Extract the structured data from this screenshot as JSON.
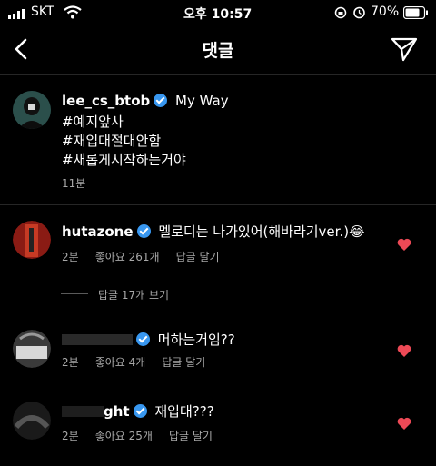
{
  "status_bar": {
    "carrier": "SKT",
    "time": "오후 10:57",
    "battery": "70%",
    "icons": [
      "signal-icon",
      "wifi-icon",
      "rotation-lock-icon",
      "alarm-icon",
      "battery-icon"
    ]
  },
  "header": {
    "title": "댓글",
    "back_icon": "chevron-left-icon",
    "share_icon": "paper-plane-icon"
  },
  "caption": {
    "username": "lee_cs_btob",
    "text": "My Way",
    "lines": [
      "#예지앞사",
      "#재입대절대안함",
      "#새롭게시작하는거야"
    ],
    "time": "11분"
  },
  "comments": [
    {
      "username": "hutazone",
      "text": "멜로디는 나가있어(해바라기ver.)😂",
      "time": "2분",
      "likes": "좋아요 261개",
      "reply": "답글 달기",
      "view_replies": "답글 17개 보기"
    },
    {
      "username": "",
      "text": "머하는거임??",
      "time": "2분",
      "likes": "좋아요 4개",
      "reply": "답글 달기"
    },
    {
      "username": "ght",
      "text": "재입대???",
      "time": "2분",
      "likes": "좋아요 25개",
      "reply": "답글 달기"
    }
  ],
  "colors": {
    "background": "#000000",
    "verified": "#3897f0",
    "heart": "#ed4956",
    "secondary_text": "#a8a8a8"
  }
}
